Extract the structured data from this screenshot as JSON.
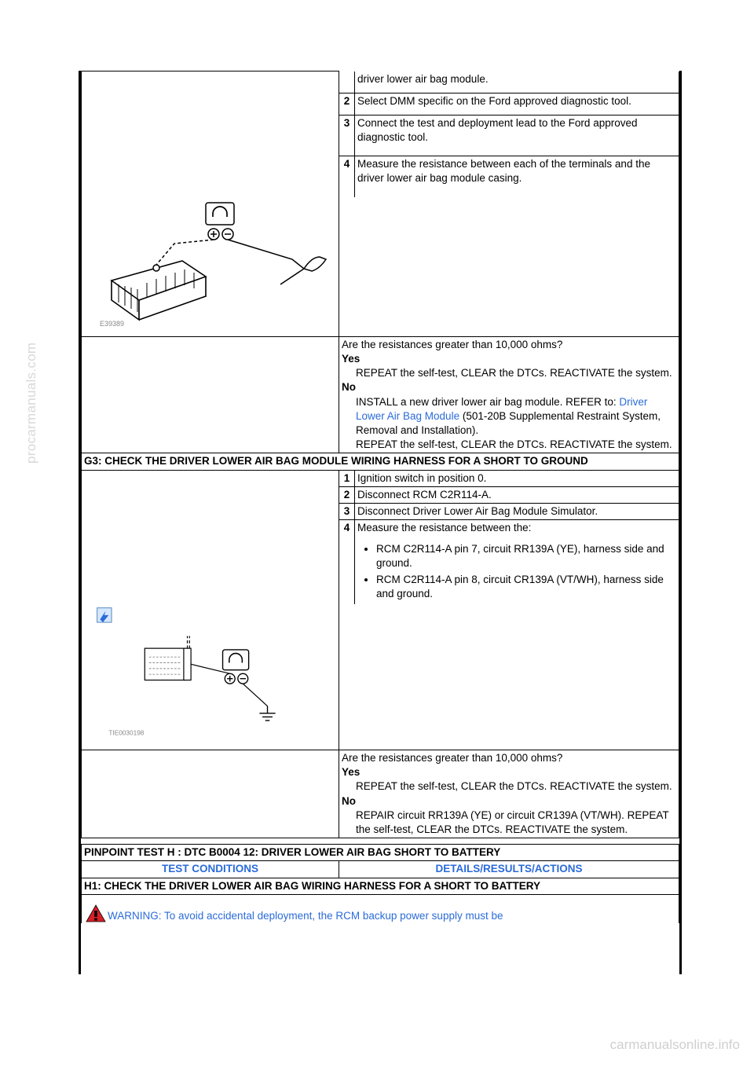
{
  "sidetext": "procarmanuals.com",
  "footer": "carmanualsonline.info",
  "g2": {
    "step1_cont": "driver lower air bag module.",
    "step2": "Select DMM specific on the Ford approved diagnostic tool.",
    "step3": "Connect the test and deployment lead to the Ford approved diagnostic tool.",
    "step4": "Measure the resistance between each of the terminals and the driver lower air bag module casing.",
    "img_id": "E39389",
    "question": "Are the resistances greater than 10,000 ohms?",
    "yes_label": "Yes",
    "yes_text": "REPEAT the self-test, CLEAR the DTCs. REACTIVATE the system.",
    "no_label": "No",
    "no_text1": "INSTALL a new driver lower air bag module. REFER to: ",
    "no_link": "Driver Lower Air Bag Module",
    "no_text2": " (501-20B Supplemental Restraint System, Removal and Installation).",
    "no_text3": "REPEAT the self-test, CLEAR the DTCs. REACTIVATE the system."
  },
  "g3": {
    "title": "G3: CHECK THE DRIVER LOWER AIR BAG MODULE WIRING HARNESS FOR A SHORT TO GROUND",
    "step1": "Ignition switch in position 0.",
    "step2": "Disconnect RCM C2R114-A.",
    "step3": "Disconnect Driver Lower Air Bag Module Simulator.",
    "step4": "Measure the resistance between the:",
    "bullet1": "RCM C2R114-A pin 7, circuit RR139A (YE), harness side and ground.",
    "bullet2": "RCM C2R114-A pin 8, circuit CR139A (VT/WH), harness side and ground.",
    "img_id": "TIE0030198",
    "question": "Are the resistances greater than 10,000 ohms?",
    "yes_label": "Yes",
    "yes_text": "REPEAT the self-test, CLEAR the DTCs. REACTIVATE the system.",
    "no_label": "No",
    "no_text": "REPAIR circuit RR139A (YE) or circuit CR139A (VT/WH). REPEAT the self-test, CLEAR the DTCs. REACTIVATE the system."
  },
  "h": {
    "title": "PINPOINT TEST H : DTC B0004 12: DRIVER LOWER AIR BAG SHORT TO BATTERY",
    "col1": "TEST CONDITIONS",
    "col2": "DETAILS/RESULTS/ACTIONS",
    "h1_title": "H1: CHECK THE DRIVER LOWER AIR BAG WIRING HARNESS FOR A SHORT TO BATTERY",
    "warning": "WARNING: To avoid accidental deployment, the RCM backup power supply must be"
  }
}
